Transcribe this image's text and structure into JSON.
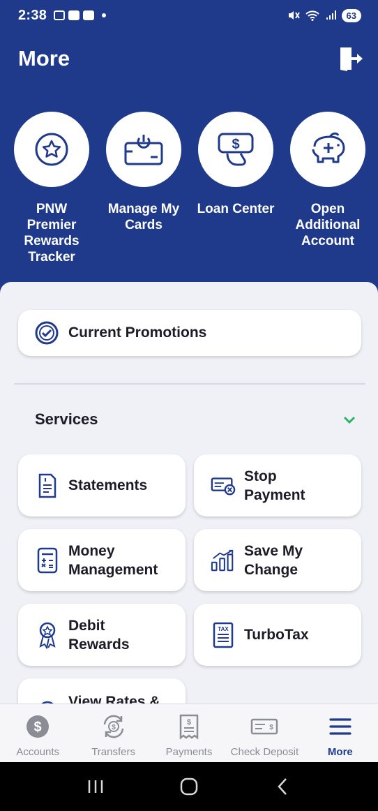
{
  "status_bar": {
    "time": "2:38",
    "battery": "63"
  },
  "header": {
    "title": "More"
  },
  "quick_actions": [
    {
      "label": "PNW Premier Rewards Tracker",
      "icon": "star-badge-icon"
    },
    {
      "label": "Manage My Cards",
      "icon": "card-power-icon"
    },
    {
      "label": "Loan Center",
      "icon": "hand-money-icon"
    },
    {
      "label": "Open Additional Account",
      "icon": "piggy-bank-icon"
    }
  ],
  "promo": {
    "label": "Current Promotions",
    "icon": "check-circle-icon"
  },
  "services": {
    "title": "Services",
    "items": [
      {
        "label": "Statements",
        "icon": "document-icon"
      },
      {
        "label": "Stop Payment",
        "icon": "check-cancel-icon"
      },
      {
        "label": "Money Management",
        "icon": "calculator-icon"
      },
      {
        "label": "Save My Change",
        "icon": "growth-bars-icon"
      },
      {
        "label": "Debit Rewards",
        "icon": "ribbon-award-icon"
      },
      {
        "label": "TurboTax",
        "icon": "tax-form-icon"
      },
      {
        "label": "View Rates &",
        "icon": "rates-icon"
      }
    ]
  },
  "bottom_nav": [
    {
      "label": "Accounts",
      "icon": "dollar-circle-icon",
      "active": false
    },
    {
      "label": "Transfers",
      "icon": "transfer-cycle-icon",
      "active": false
    },
    {
      "label": "Payments",
      "icon": "bill-icon",
      "active": false
    },
    {
      "label": "Check Deposit",
      "icon": "check-icon",
      "active": false
    },
    {
      "label": "More",
      "icon": "menu-icon",
      "active": true
    }
  ],
  "colors": {
    "brand": "#1f3a8a",
    "accent_green": "#2fb36b",
    "background": "#f0f1f6"
  }
}
